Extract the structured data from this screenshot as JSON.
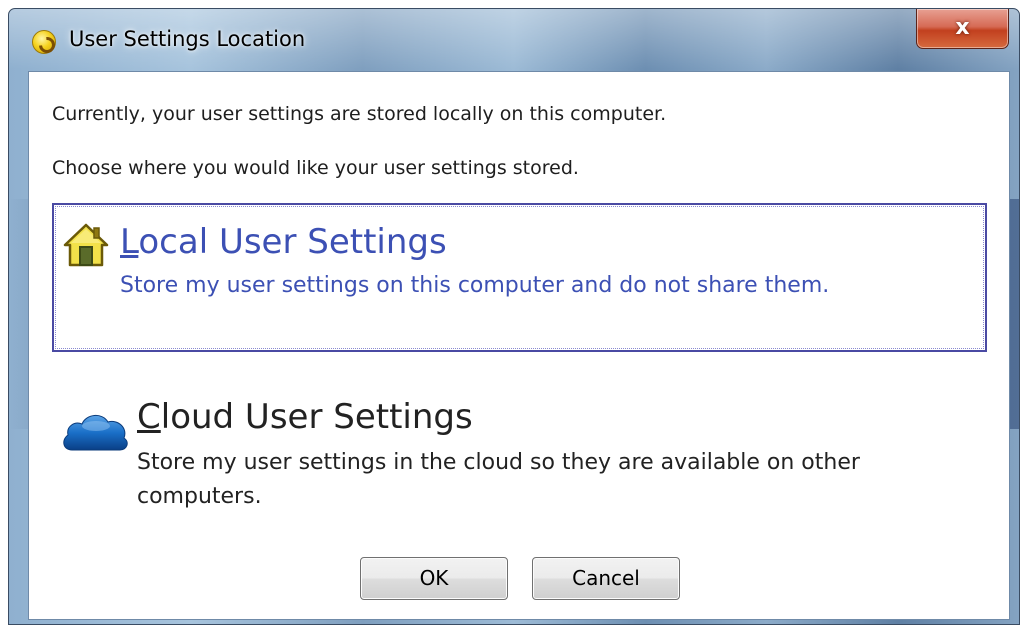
{
  "window": {
    "title": "User Settings Location",
    "close_label": "x"
  },
  "messages": {
    "current": "Currently, your user settings are stored locally on this computer.",
    "prompt": "Choose where you would like your user settings stored."
  },
  "options": {
    "local": {
      "title_first_letter": "L",
      "title_rest": "ocal User Settings",
      "description": "Store my user settings on this computer and do not share them.",
      "icon": "house-icon",
      "selected": true
    },
    "cloud": {
      "title_first_letter": "C",
      "title_rest": "loud User Settings",
      "description": "Store my user settings in the cloud so they are available on other computers.",
      "icon": "cloud-icon",
      "selected": false
    }
  },
  "buttons": {
    "ok": "OK",
    "cancel": "Cancel"
  },
  "colors": {
    "link_blue": "#3c50b4",
    "selection_border": "#4a4aa3",
    "close_red": "#c2401f"
  }
}
